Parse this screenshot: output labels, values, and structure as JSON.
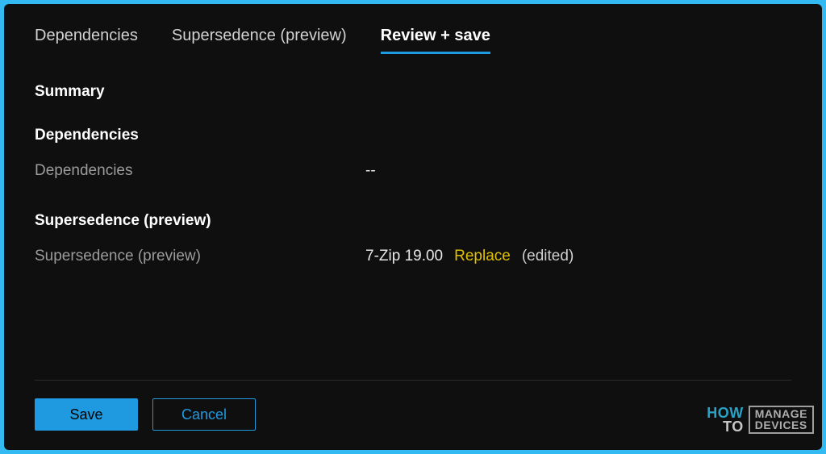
{
  "tabs": {
    "dependencies": "Dependencies",
    "supersedence": "Supersedence (preview)",
    "review_save": "Review + save"
  },
  "summary_heading": "Summary",
  "groups": {
    "dependencies": {
      "title": "Dependencies",
      "row_label": "Dependencies",
      "row_value": "--"
    },
    "supersedence": {
      "title": "Supersedence (preview)",
      "row_label": "Supersedence (preview)",
      "app_name": "7-Zip 19.00",
      "action": "Replace",
      "note": "(edited)"
    }
  },
  "buttons": {
    "save": "Save",
    "cancel": "Cancel"
  },
  "watermark": {
    "how": "HOW",
    "to": "TO",
    "manage": "MANAGE",
    "devices": "DEVICES"
  }
}
